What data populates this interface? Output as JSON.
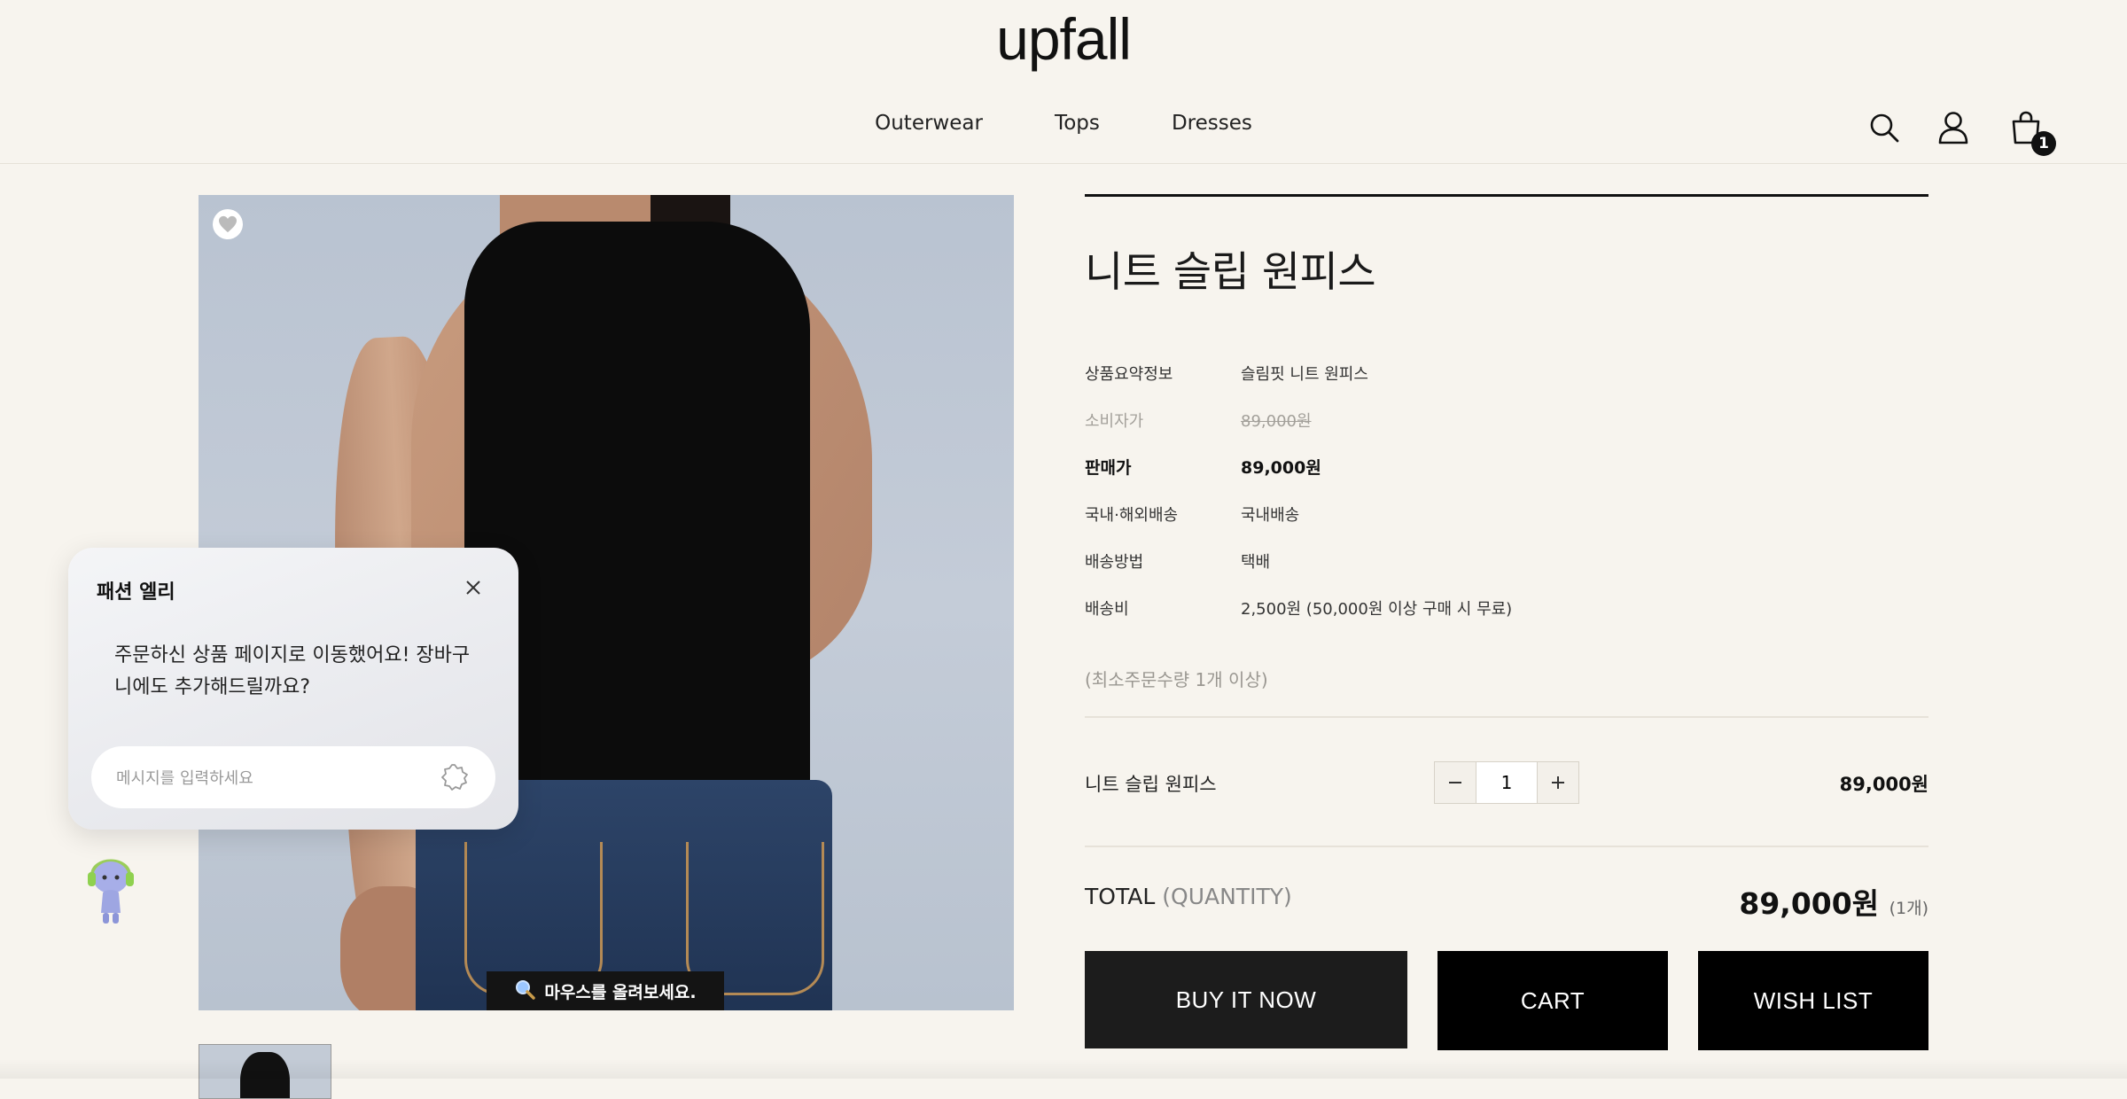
{
  "header": {
    "logo": "upfall",
    "nav": [
      "Outerwear",
      "Tops",
      "Dresses"
    ],
    "cart_count": "1",
    "icons": [
      "search-icon",
      "user-icon",
      "shopping-bag-icon"
    ]
  },
  "gallery": {
    "zoom_hint": "마우스를 올려보세요.",
    "zoom_icon": "magnifier-icon"
  },
  "product": {
    "title": "니트 슬립 원피스",
    "specs": [
      {
        "label": "상품요약정보",
        "value": "슬림핏 니트 원피스"
      },
      {
        "label": "소비자가",
        "value": "89,000원"
      },
      {
        "label": "판매가",
        "value": "89,000원"
      },
      {
        "label": "국내·해외배송",
        "value": "국내배송"
      },
      {
        "label": "배송방법",
        "value": "택배"
      },
      {
        "label": "배송비",
        "value": "2,500원 (50,000원 이상 구매 시 무료)"
      }
    ],
    "min_order": "(최소주문수량 1개 이상)",
    "line_item": {
      "name": "니트 슬립 원피스",
      "quantity": "1",
      "price": "89,000원"
    },
    "total": {
      "label": "TOTAL",
      "label_sub": "(QUANTITY)",
      "amount": "89,000원",
      "count": "(1개)"
    },
    "buttons": {
      "buy": "BUY IT NOW",
      "cart": "CART",
      "wish": "WISH LIST"
    }
  },
  "chat": {
    "title": "패션 엘리",
    "message": "주문하신 상품 페이지로 이동했어요! 장바구니에도 추가해드릴까요?",
    "placeholder": "메시지를 입력하세요"
  },
  "colors": {
    "background": "#f7f4ee",
    "button_dark": "#1c1c1c",
    "button_black": "#000000",
    "text": "#1a1a1a",
    "muted": "#a3a09a"
  }
}
